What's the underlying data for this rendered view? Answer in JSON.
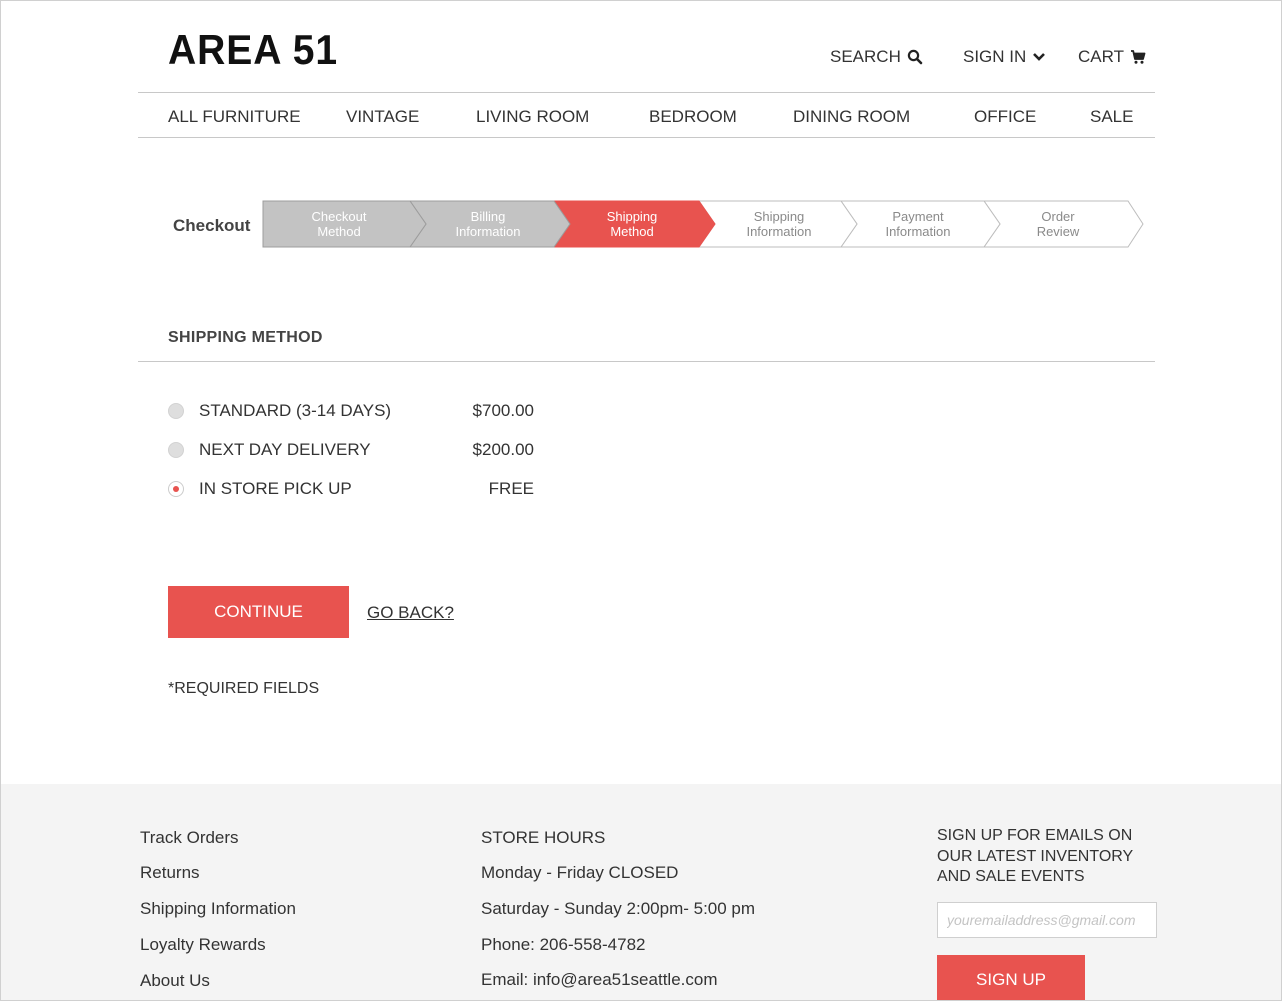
{
  "header": {
    "logo": "AREA 51",
    "search_label": "SEARCH",
    "signin_label": "SIGN IN",
    "cart_label": "CART"
  },
  "nav": {
    "items": [
      "ALL FURNITURE",
      "VINTAGE",
      "LIVING ROOM",
      "BEDROOM",
      "DINING ROOM",
      "OFFICE",
      "SALE"
    ]
  },
  "checkout": {
    "label": "Checkout",
    "steps": [
      {
        "line1": "Checkout",
        "line2": "Method",
        "state": "completed"
      },
      {
        "line1": "Billing",
        "line2": "Information",
        "state": "completed"
      },
      {
        "line1": "Shipping",
        "line2": "Method",
        "state": "current"
      },
      {
        "line1": "Shipping",
        "line2": "Information",
        "state": "upcoming"
      },
      {
        "line1": "Payment",
        "line2": "Information",
        "state": "upcoming"
      },
      {
        "line1": "Order",
        "line2": "Review",
        "state": "upcoming"
      }
    ]
  },
  "shipping": {
    "title": "SHIPPING METHOD",
    "options": [
      {
        "label": "STANDARD (3-14 DAYS)",
        "price": "$700.00",
        "selected": false
      },
      {
        "label": "NEXT DAY DELIVERY",
        "price": "$200.00",
        "selected": false
      },
      {
        "label": "IN STORE PICK UP",
        "price": "FREE",
        "selected": true
      }
    ],
    "continue_label": "CONTINUE",
    "go_back_label": "GO BACK?",
    "required_note": "*REQUIRED FIELDS"
  },
  "footer": {
    "links": [
      "Track Orders",
      "Returns",
      "Shipping Information",
      "Loyalty Rewards",
      "About Us"
    ],
    "store_hours": {
      "title": "STORE HOURS",
      "weekday": "Monday - Friday CLOSED",
      "weekend": "Saturday - Sunday 2:00pm- 5:00 pm",
      "phone": "Phone: 206-558-4782",
      "email": "Email: info@area51seattle.com"
    },
    "signup": {
      "title_lines": [
        "SIGN UP FOR EMAILS ON",
        "OUR LATEST INVENTORY",
        "AND SALE EVENTS"
      ],
      "email_placeholder": "youremailaddress@gmail.com",
      "button_label": "SIGN UP"
    }
  },
  "colors": {
    "accent": "#e8534f",
    "step_completed": "#c3c3c3",
    "footer_bg": "#f4f4f4",
    "divider": "#c8c8c8"
  },
  "icons": {
    "search": "search-icon",
    "signin": "chevron-down-icon",
    "cart": "cart-icon"
  }
}
